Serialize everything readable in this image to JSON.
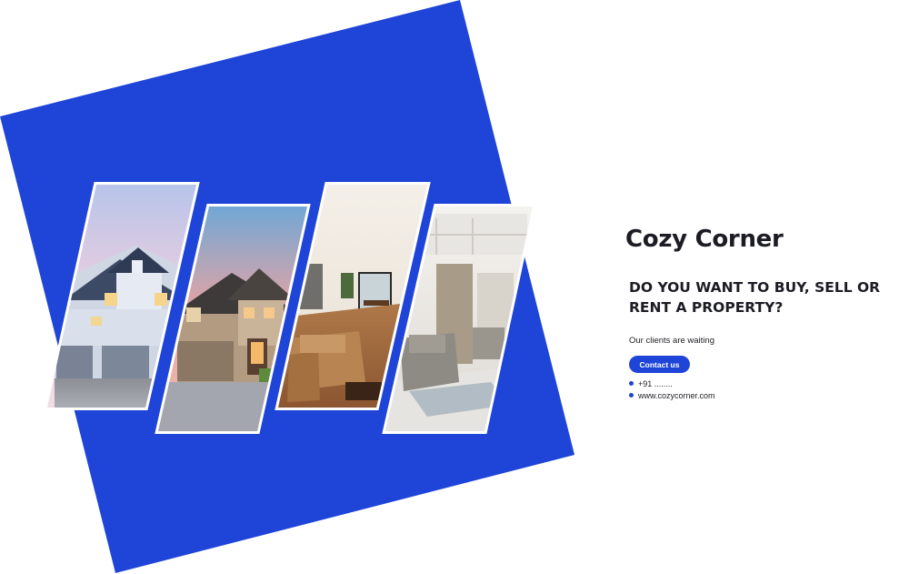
{
  "brand": {
    "name": "Cozy Corner"
  },
  "headline": "DO YOU WANT TO BUY, SELL OR RENT A PROPERTY?",
  "tagline": "Our clients are waiting",
  "contact_button": {
    "label": "Contact us"
  },
  "contact_info": [
    {
      "icon": "bullet-icon",
      "text": "+91 ........"
    },
    {
      "icon": "bullet-icon",
      "text": "www.cozycorner.com"
    }
  ],
  "photos": [
    {
      "icon": "house-exterior-icon",
      "subject": "house-exterior-blue"
    },
    {
      "icon": "house-exterior-icon",
      "subject": "house-exterior-sunset"
    },
    {
      "icon": "living-room-icon",
      "subject": "living-room-sofa"
    },
    {
      "icon": "interior-room-icon",
      "subject": "interior-armchair"
    }
  ],
  "colors": {
    "accent": "#1e44d8",
    "text": "#1c1c24",
    "background": "#ffffff"
  }
}
